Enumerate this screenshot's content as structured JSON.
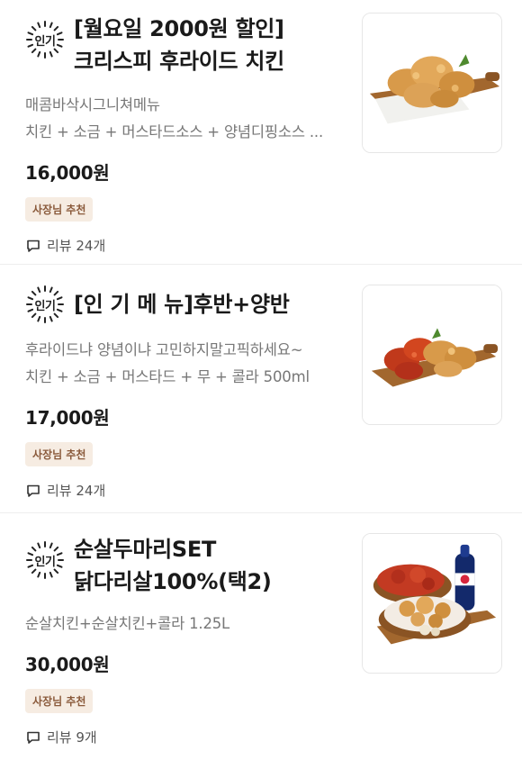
{
  "menu_items": [
    {
      "badge": "인기",
      "title_line1": "[월요일 2000원 할인]",
      "title_line2": "크리스피 후라이드 치킨",
      "desc_line1": "매콤바삭시그니쳐메뉴",
      "desc_line2": "치킨 + 소금 + 머스타드소스 + 양념디핑소스 ...",
      "price": "16,000원",
      "tag": "사장님 추천",
      "review": "리뷰 24개",
      "image_icon": "crispy-fried-chicken-image"
    },
    {
      "badge": "인기",
      "title_line1": "[인 기 메 뉴]후반+양반",
      "desc_line1": "후라이드냐 양념이냐 고민하지말고픽하세요~",
      "desc_line2": "치킨 + 소금 + 머스타드 + 무 + 콜라 500ml",
      "price": "17,000원",
      "tag": "사장님 추천",
      "review": "리뷰 24개",
      "image_icon": "half-half-chicken-image"
    },
    {
      "badge": "인기",
      "title_line1": "순살두마리SET",
      "title_line2": "닭다리살100%(택2)",
      "desc_line1": "순살치킨+순살치킨+콜라 1.25L",
      "price": "30,000원",
      "tag": "사장님 추천",
      "review": "리뷰 9개",
      "image_icon": "boneless-chicken-set-with-cola-image"
    }
  ],
  "colors": {
    "tag_bg": "#f6ece2",
    "tag_text": "#8a5a3b",
    "desc_text": "#777777"
  }
}
